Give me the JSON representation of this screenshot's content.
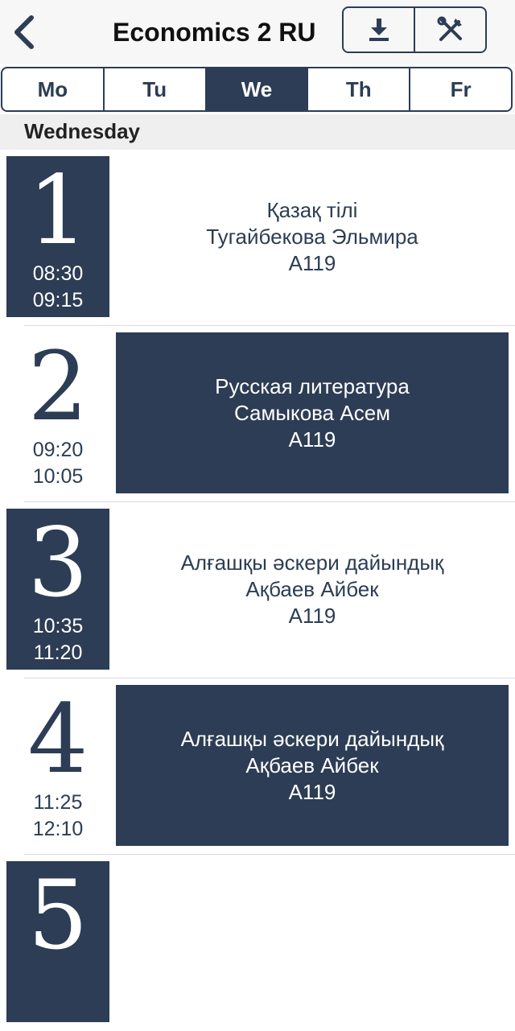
{
  "header": {
    "title": "Economics 2 RU",
    "back_icon": "chevron-left-icon",
    "download_icon": "download-icon",
    "settings_icon": "tools-icon"
  },
  "days": [
    {
      "label": "Mo",
      "active": false
    },
    {
      "label": "Tu",
      "active": false
    },
    {
      "label": "We",
      "active": true
    },
    {
      "label": "Th",
      "active": false
    },
    {
      "label": "Fr",
      "active": false
    }
  ],
  "section_title": "Wednesday",
  "colors": {
    "accent": "#2c3d55",
    "background": "#ffffff",
    "header_bg": "#f7f7f7"
  },
  "lessons": [
    {
      "number": "1",
      "start": "08:30",
      "end": "09:15",
      "subject": "Қазақ тілі",
      "teacher": "Тугайбекова Эльмира",
      "room": "A119",
      "highlight": "number"
    },
    {
      "number": "2",
      "start": "09:20",
      "end": "10:05",
      "subject": "Русская литература",
      "teacher": "Самыкова Асем",
      "room": "A119",
      "highlight": "info"
    },
    {
      "number": "3",
      "start": "10:35",
      "end": "11:20",
      "subject": "Алғашқы әскери дайындық",
      "teacher": "Ақбаев Айбек",
      "room": "A119",
      "highlight": "number"
    },
    {
      "number": "4",
      "start": "11:25",
      "end": "12:10",
      "subject": "Алғашқы әскери дайындық",
      "teacher": "Ақбаев Айбек",
      "room": "A119",
      "highlight": "info"
    },
    {
      "number": "5",
      "start": "",
      "end": "",
      "subject": "",
      "teacher": "",
      "room": "",
      "highlight": "number"
    }
  ]
}
